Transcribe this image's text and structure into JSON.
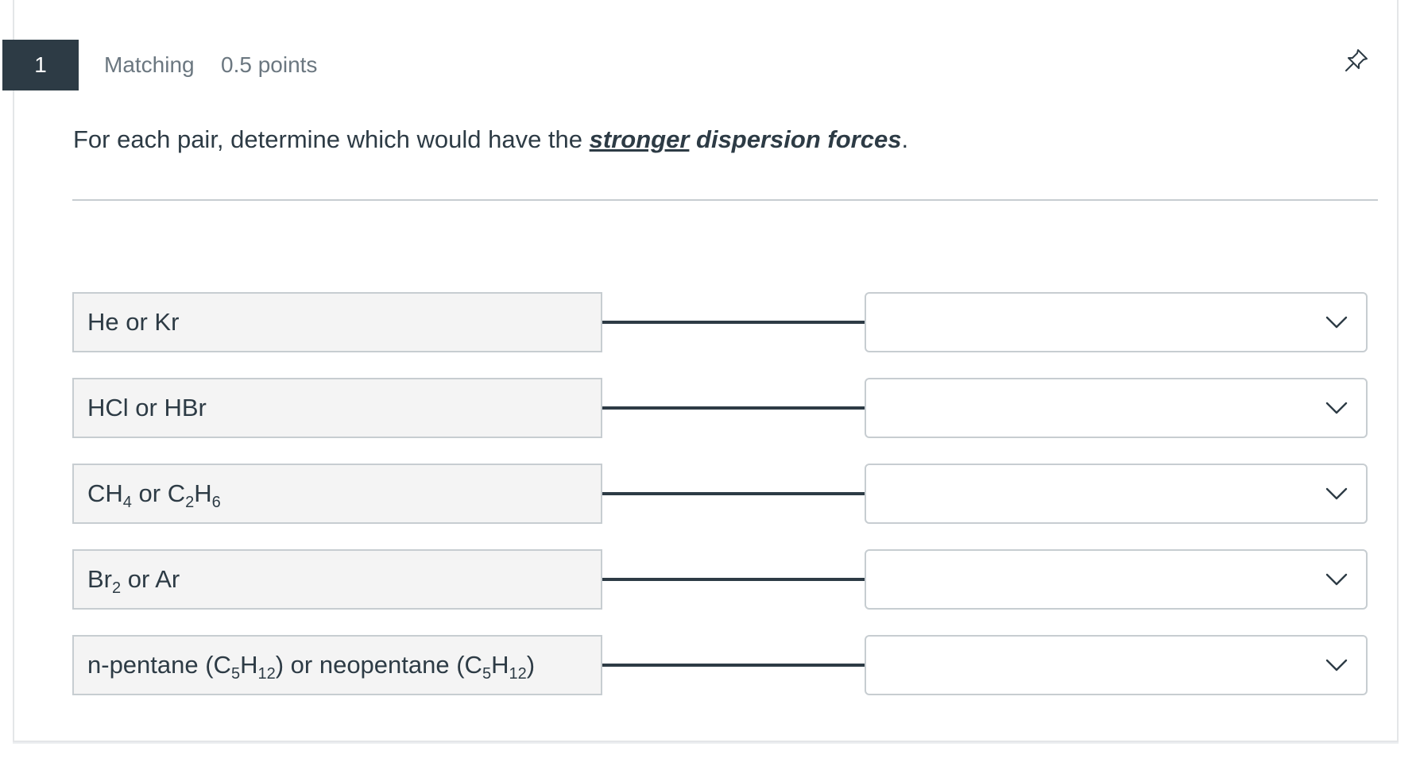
{
  "question": {
    "number": "1",
    "type": "Matching",
    "points": "0.5 points",
    "prompt": {
      "before": "For each pair, determine which would have the ",
      "emphasis_underlined": "stronger",
      "emphasis_space": " ",
      "emphasis_rest": "dispersion forces",
      "after": "."
    }
  },
  "pairs": [
    {
      "parts": [
        {
          "t": "He or Kr"
        }
      ],
      "selected": ""
    },
    {
      "parts": [
        {
          "t": "HCl or HBr"
        }
      ],
      "selected": ""
    },
    {
      "parts": [
        {
          "t": "CH"
        },
        {
          "s": "4"
        },
        {
          "t": " or C"
        },
        {
          "s": "2"
        },
        {
          "t": "H"
        },
        {
          "s": "6"
        }
      ],
      "selected": ""
    },
    {
      "parts": [
        {
          "t": "Br"
        },
        {
          "s": "2"
        },
        {
          "t": " or Ar"
        }
      ],
      "selected": ""
    },
    {
      "parts": [
        {
          "t": "n-pentane (C"
        },
        {
          "s": "5"
        },
        {
          "t": "H"
        },
        {
          "s": "12"
        },
        {
          "t": ") or neopentane (C"
        },
        {
          "s": "5"
        },
        {
          "t": "H"
        },
        {
          "s": "12"
        },
        {
          "t": ")"
        }
      ],
      "selected": ""
    }
  ],
  "icons": {
    "pin": "pin-icon",
    "dropdown": "chevron-down-icon"
  },
  "colors": {
    "number_badge": "#2d3b45",
    "text": "#2d3b45",
    "muted": "#6b7780",
    "border": "#c7cdd1",
    "left_box_bg": "#f4f4f4"
  }
}
